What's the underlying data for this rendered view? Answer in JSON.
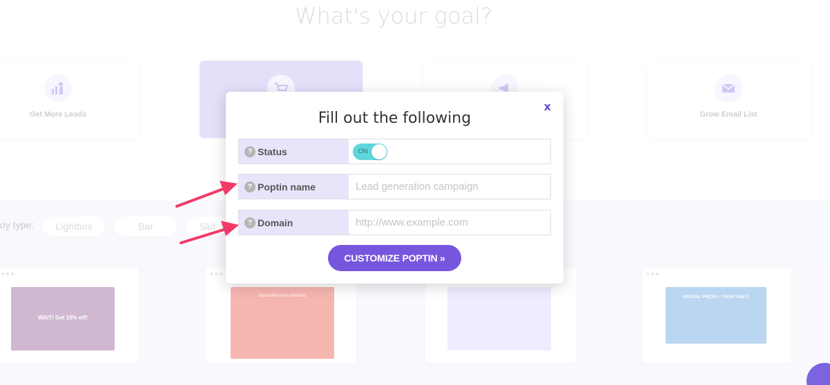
{
  "background": {
    "heading": "What's your goal?",
    "goals": [
      {
        "label": "Get More Leads",
        "icon": "leads-chart-icon"
      },
      {
        "label": "",
        "icon": "cart-icon"
      },
      {
        "label": "",
        "icon": "megaphone-icon"
      },
      {
        "label": "Grow Email List",
        "icon": "envelope-icon"
      }
    ],
    "popup_type_label": "oy type:",
    "popup_types": [
      "Lightbox",
      "Bar",
      "Slid"
    ],
    "thumbnails": {
      "lightbox_headline": "WAIT! Get 10% off!",
      "subscribe_text": "Subscribe to our email list",
      "special_prices": "SPECIAL PRICES - TODAY ONLY!"
    }
  },
  "modal": {
    "title": "Fill out the following",
    "close_label": "x",
    "help_glyph": "?",
    "status": {
      "label": "Status",
      "toggle_text": "ON",
      "on": true
    },
    "poptin_name": {
      "label": "Poptin name",
      "placeholder": "Lead generation campaign",
      "value": ""
    },
    "domain": {
      "label": "Domain",
      "placeholder": "http://www.example.com",
      "value": ""
    },
    "cta_label": "CUSTOMIZE POPTIN »"
  },
  "colors": {
    "accent": "#7656dd",
    "toggle_on": "#5fd6dd",
    "label_bg": "#e8e5fb",
    "arrow": "#f23a68"
  }
}
